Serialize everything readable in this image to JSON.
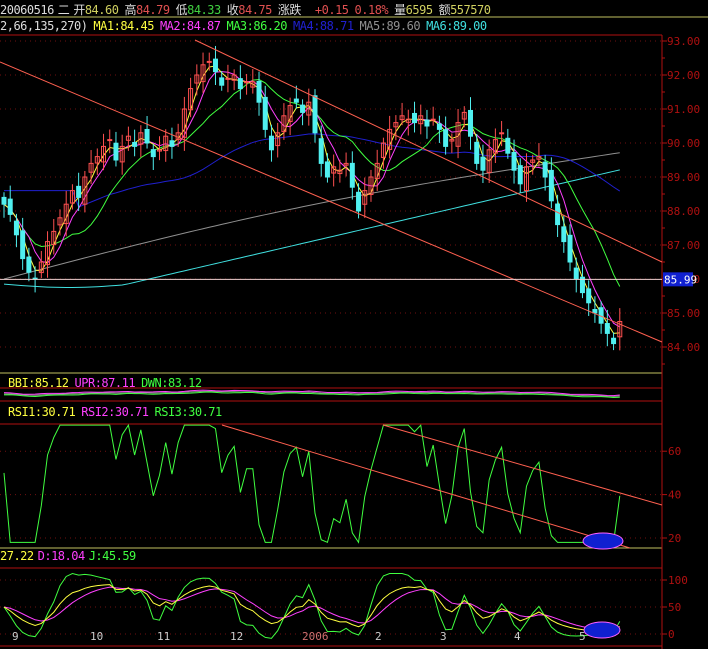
{
  "header": {
    "date": "20060516",
    "weekday": "二",
    "open_label": "开",
    "open": "84.60",
    "high_label": "高",
    "high": "84.79",
    "low_label": "低",
    "low": "84.33",
    "close_label": "收",
    "close": "84.75",
    "change_label": "涨跌",
    "change": "+0.15",
    "change_pct": "0.18%",
    "volume_label": "量",
    "volume": "6595",
    "amount_label": "额",
    "amount": "557570"
  },
  "ma_legend": {
    "params": "2,66,135,270)",
    "items": [
      {
        "label": "MA1:84.45",
        "color": "#ffff40"
      },
      {
        "label": "MA2:84.87",
        "color": "#ff40ff"
      },
      {
        "label": "MA3:86.20",
        "color": "#40ff40"
      },
      {
        "label": "MA4:88.71",
        "color": "#2020d0"
      },
      {
        "label": "MA5:89.60",
        "color": "#909090"
      },
      {
        "label": "MA6:89.00",
        "color": "#40e0e0"
      }
    ]
  },
  "bbi_legend": [
    {
      "label": "BBI:85.12",
      "color": "#ffff40"
    },
    {
      "label": "UPR:87.11",
      "color": "#ff40ff"
    },
    {
      "label": "DWN:83.12",
      "color": "#40ff40"
    }
  ],
  "rsi_legend": [
    {
      "label": "RSI1:30.71",
      "color": "#ffff40"
    },
    {
      "label": "RSI2:30.71",
      "color": "#ff40ff"
    },
    {
      "label": "RSI3:30.71",
      "color": "#40ff40"
    }
  ],
  "kdj_legend": [
    {
      "label": "27.22",
      "color": "#ffff40"
    },
    {
      "label": "D:18.04",
      "color": "#ff40ff"
    },
    {
      "label": "J:45.59",
      "color": "#40ff40"
    }
  ],
  "price_axis": [
    "93.00",
    "92.00",
    "91.00",
    "90.00",
    "89.00",
    "88.00",
    "87.00",
    "86.00",
    "85.00",
    "84.00"
  ],
  "current_price_tag": "85.99",
  "rsi_axis": [
    "60",
    "40",
    "20"
  ],
  "kdj_axis": [
    "100",
    "50",
    "0"
  ],
  "date_labels": [
    "9",
    "10",
    "11",
    "12",
    "2006",
    "2",
    "3",
    "4",
    "5"
  ],
  "colors": {
    "up": "#ff5050",
    "down": "#50f0f0",
    "axis": "#b01010",
    "trend": "#ff6050",
    "highlight": "#1020d0"
  },
  "chart_data": {
    "type": "candlestick",
    "ylim": [
      83.5,
      93.2
    ],
    "closes": [
      88.2,
      87.9,
      87.3,
      86.6,
      86.2,
      86.0,
      86.5,
      87.1,
      87.4,
      87.8,
      88.2,
      88.6,
      88.4,
      89.0,
      89.4,
      89.6,
      89.9,
      90.1,
      89.5,
      89.9,
      90.2,
      89.9,
      90.3,
      90.0,
      89.6,
      89.8,
      90.2,
      89.9,
      90.3,
      91.0,
      91.6,
      92.0,
      92.3,
      92.4,
      92.1,
      91.7,
      91.9,
      92.0,
      91.6,
      91.8,
      91.8,
      91.2,
      90.4,
      89.8,
      90.3,
      90.8,
      91.1,
      91.2,
      90.9,
      91.2,
      90.3,
      89.4,
      89.0,
      89.3,
      89.2,
      89.4,
      88.7,
      88.0,
      88.6,
      89.0,
      89.4,
      90.0,
      90.4,
      90.6,
      90.8,
      90.7,
      90.6,
      90.8,
      90.5,
      90.7,
      90.4,
      89.9,
      90.1,
      90.6,
      90.9,
      90.2,
      89.4,
      89.2,
      89.8,
      90.1,
      90.3,
      89.7,
      89.2,
      88.8,
      89.3,
      89.5,
      89.6,
      89.0,
      88.3,
      87.6,
      87.1,
      86.5,
      86.0,
      85.6,
      85.3,
      85.0,
      84.7,
      84.4,
      84.1,
      84.75
    ],
    "horizontal_line": 85.99
  }
}
